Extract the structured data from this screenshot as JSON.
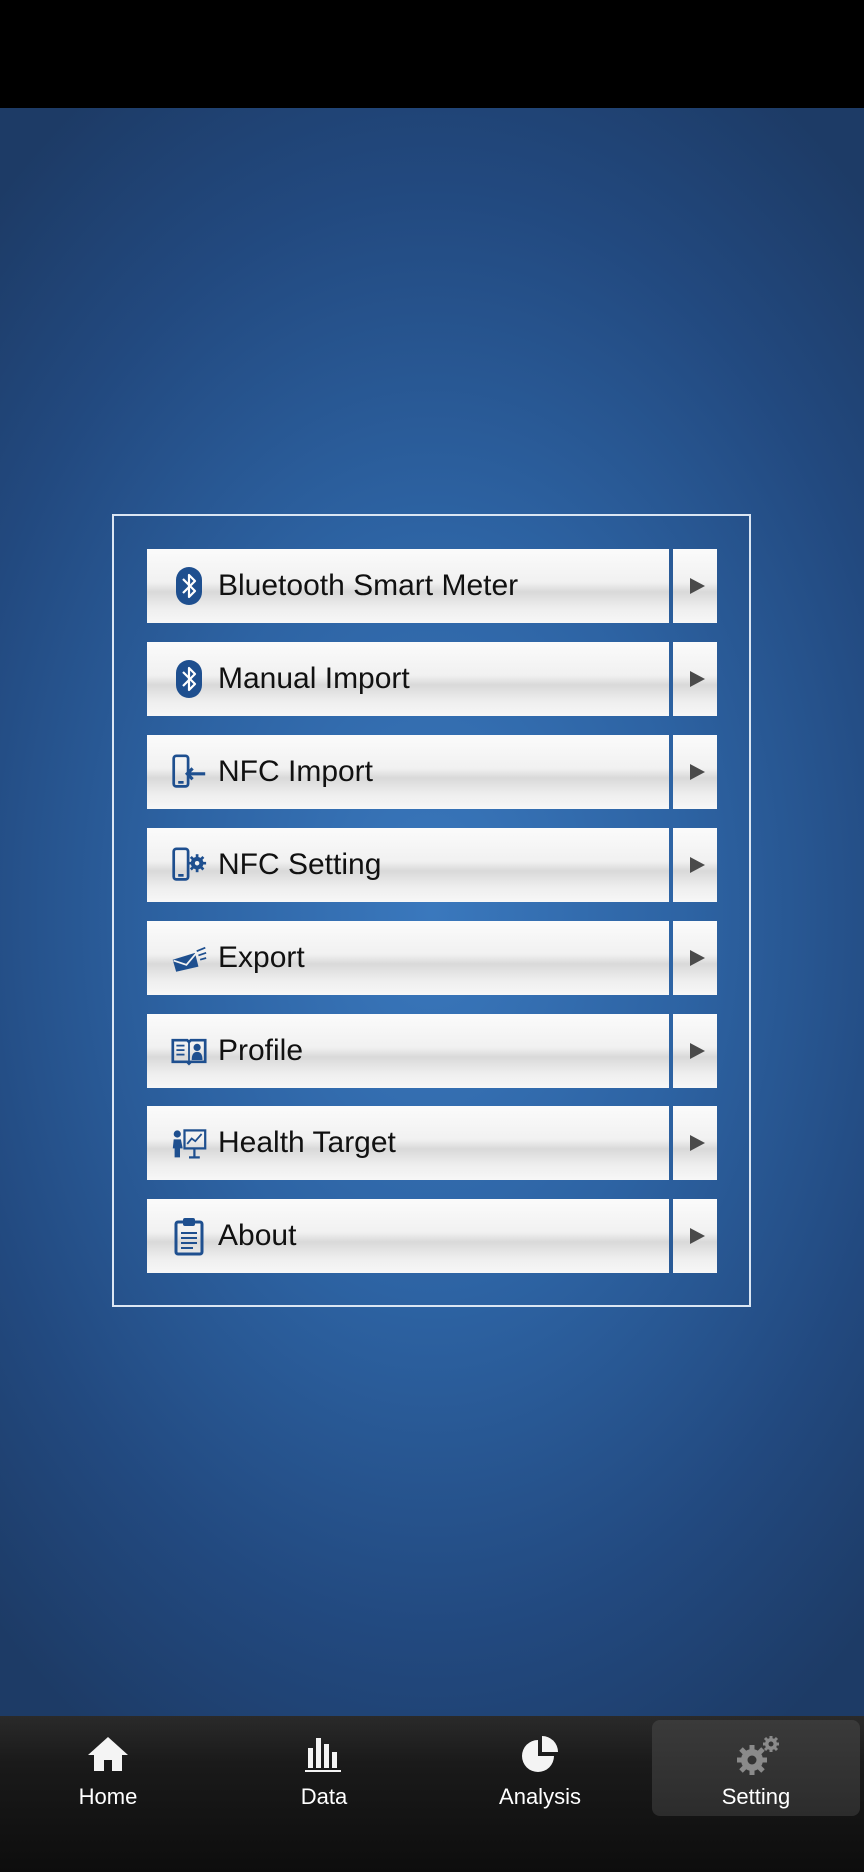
{
  "menu": {
    "items": [
      {
        "label": "Bluetooth Smart Meter",
        "icon": "bluetooth-icon"
      },
      {
        "label": "Manual Import",
        "icon": "bluetooth-icon"
      },
      {
        "label": "NFC Import",
        "icon": "phone-import-icon"
      },
      {
        "label": "NFC Setting",
        "icon": "phone-gear-icon"
      },
      {
        "label": "Export",
        "icon": "envelope-icon"
      },
      {
        "label": "Profile",
        "icon": "book-user-icon"
      },
      {
        "label": "Health Target",
        "icon": "presentation-icon"
      },
      {
        "label": "About",
        "icon": "clipboard-icon"
      }
    ]
  },
  "tabbar": {
    "tabs": [
      {
        "label": "Home",
        "icon": "home-icon"
      },
      {
        "label": "Data",
        "icon": "bar-chart-icon"
      },
      {
        "label": "Analysis",
        "icon": "pie-chart-icon"
      },
      {
        "label": "Setting",
        "icon": "gear-icon",
        "active": true
      }
    ]
  },
  "colors": {
    "background": "#2d63a3",
    "icon_blue": "#1e4f8f",
    "tab_active_icon": "#8a8a8a"
  }
}
